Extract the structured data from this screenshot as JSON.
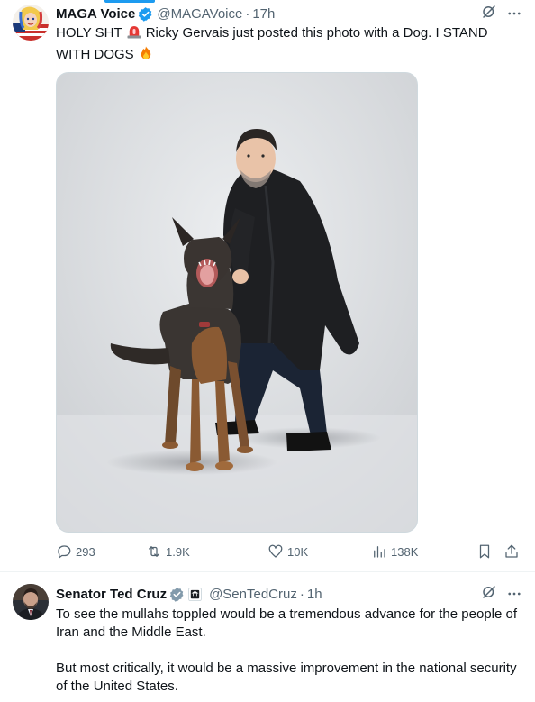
{
  "tweets": [
    {
      "display_name": "MAGA Voice",
      "handle": "@MAGAVoice",
      "separator": "·",
      "time": "17h",
      "text_part1": "HOLY SHT",
      "text_part2": "Ricky Gervais just posted this photo with a Dog. I STAND WITH DOGS",
      "actions": {
        "replies": "293",
        "reposts": "1.9K",
        "likes": "10K",
        "views": "138K"
      },
      "icons": [
        "verified-badge-icon",
        "grok-icon",
        "more-icon",
        "reply-icon",
        "repost-icon",
        "like-icon",
        "views-icon",
        "bookmark-icon",
        "share-icon",
        "siren-emoji",
        "fire-emoji"
      ]
    },
    {
      "display_name": "Senator Ted Cruz",
      "handle": "@SenTedCruz",
      "separator": "·",
      "time": "1h",
      "paragraphs": [
        "To see the mullahs toppled would be a tremendous advance for the people of Iran and the Middle East.",
        "But most critically, it would be a massive improvement in the national security of the United States."
      ],
      "icons": [
        "verified-gray-badge-icon",
        "government-affiliate-icon",
        "grok-icon",
        "more-icon"
      ]
    }
  ],
  "colors": {
    "accent": "#1d9bf0",
    "text_primary": "#0f1419",
    "text_secondary": "#536471"
  }
}
